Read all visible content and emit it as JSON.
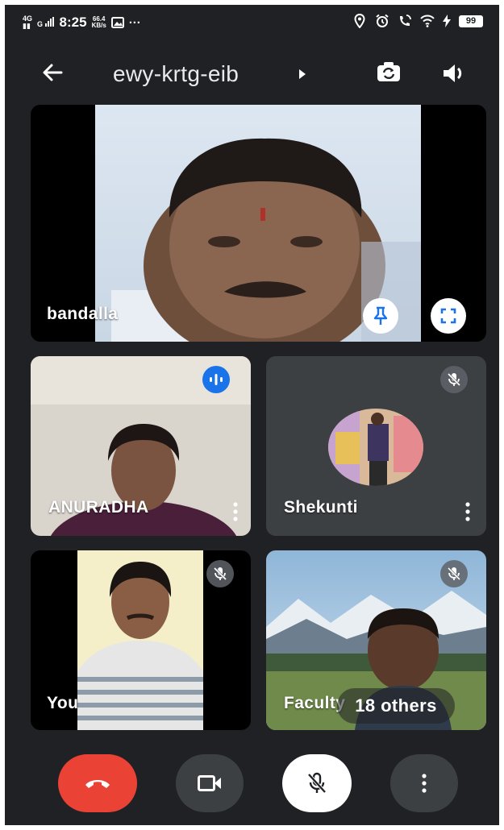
{
  "status_bar": {
    "net_top": "4G",
    "net_bottom": "G",
    "time": "8:25",
    "speed_value": "66.4",
    "speed_unit": "KB/s",
    "more": "···",
    "battery": "99"
  },
  "header": {
    "meeting_code": "ewy-krtg-eib"
  },
  "participants": [
    {
      "name": "bandalla"
    },
    {
      "name": "ANURADHA"
    },
    {
      "name": "Shekunti"
    },
    {
      "name": "You"
    },
    {
      "name": "Faculty"
    }
  ],
  "others_label": "18 others",
  "colors": {
    "background": "#202124",
    "tile": "#3c4043",
    "end_call": "#ea4335",
    "speaking": "#1a73e8",
    "control": "#3c4043"
  },
  "icons": {
    "back": "arrow-left-icon",
    "switch_camera": "switch-camera-icon",
    "speaker": "speaker-icon",
    "pin": "pin-icon",
    "fullscreen": "fullscreen-icon",
    "speaking": "speaking-indicator-icon",
    "mic_off": "mic-off-icon",
    "more": "more-vert-icon",
    "end_call": "call-end-icon",
    "camera": "videocam-icon"
  }
}
